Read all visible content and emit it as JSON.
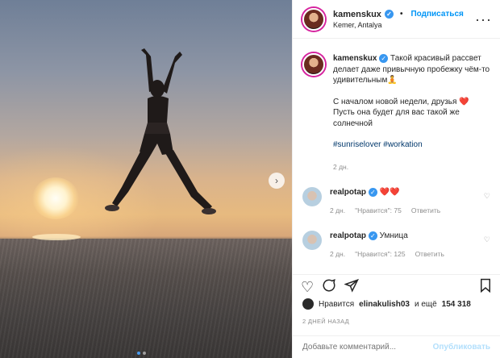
{
  "colors": {
    "accent": "#0095f6",
    "verified": "#3897f0",
    "muted": "#8e8e8e",
    "heart": "#ed4956",
    "hashtag": "#00376b"
  },
  "header": {
    "username": "kamenskux",
    "follow_label": "Подписаться",
    "separator": "•",
    "location": "Kemer, Antalya",
    "more_icon": "more-horizontal-icon"
  },
  "post": {
    "username": "kamenskux",
    "caption_line1": "Такой красивый рассвет делает даже привычную пробежку чём-то удивительным",
    "caption_emoji": "🧘",
    "caption_line2": "С началом новой недели, друзья",
    "caption_heart": "❤️",
    "caption_line3": "Пусть она будет для вас такой же солнечной",
    "hashtag1": "#sunriselover",
    "hashtag2": "#workation",
    "time": "2 дн."
  },
  "comments": [
    {
      "username": "realpotap",
      "text": "❤️❤️",
      "time": "2 дн.",
      "likes": "\"Нравится\": 75",
      "reply": "Ответить"
    },
    {
      "username": "realpotap",
      "text": "Умница",
      "time": "2 дн.",
      "likes": "\"Нравится\": 125",
      "reply": "Ответить"
    }
  ],
  "likes": {
    "prefix": "Нравится",
    "user": "elinakulish03",
    "suffix": "и ещё",
    "count": "154 318"
  },
  "date": "2 ДНЕЙ НАЗАД",
  "add_comment": {
    "placeholder": "Добавьте комментарий...",
    "publish_label": "Опубликовать"
  },
  "carousel": {
    "current": 1,
    "total": 2
  }
}
